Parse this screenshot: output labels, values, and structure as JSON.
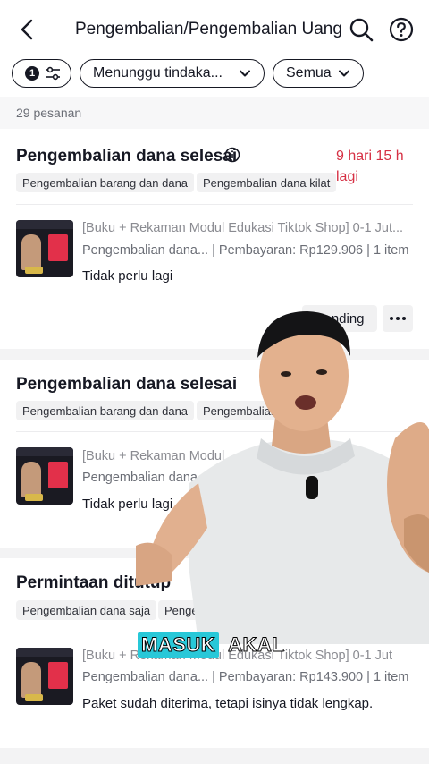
{
  "header": {
    "title": "Pengembalian/Pengembalian Uang"
  },
  "filters": {
    "count": "1",
    "status": "Menunggu tindaka...",
    "type": "Semua"
  },
  "order_count": "29 pesanan",
  "cards": [
    {
      "title": "Pengembalian dana selesai",
      "deadline": "9 hari 15 h lagi",
      "tags": [
        "Pengembalian barang dan dana",
        "Pengembalian dana kilat"
      ],
      "product_title": "[Buku + Rekaman Modul Edukasi Tiktok Shop] 0-1 Jut...",
      "product_meta": "Pengembalian dana... | Pembayaran: Rp129.906 | 1 item",
      "reason": "Tidak perlu lagi",
      "action_label": "Banding"
    },
    {
      "title": "Pengembalian dana selesai",
      "tags": [
        "Pengembalian barang dan dana",
        "Pengembalian"
      ],
      "product_title": "[Buku + Rekaman Modul",
      "product_meta": "Pengembalian dana...",
      "reason": "Tidak perlu lagi"
    },
    {
      "title": "Permintaan ditutup",
      "tags": [
        "Pengembalian dana saja",
        "Pengembalian da"
      ],
      "product_title": "[Buku + Rekaman Modul Edukasi Tiktok Shop] 0-1 Jut",
      "product_meta": "Pengembalian dana... | Pembayaran: Rp143.900 | 1 item",
      "reason": "Paket sudah diterima, tetapi isinya tidak lengkap."
    }
  ],
  "overlay": {
    "caption_words": [
      "MASUK",
      "AKAL"
    ]
  },
  "colors": {
    "accent_red": "#d63145",
    "caption_highlight": "#28c8d8"
  }
}
